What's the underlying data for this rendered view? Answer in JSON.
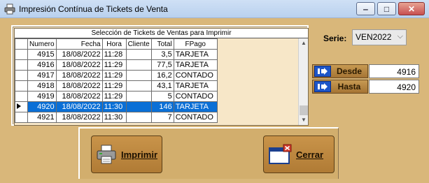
{
  "window": {
    "title": "Impresión Contínua de Tickets de Venta"
  },
  "grid": {
    "caption": "Selección de Tickets de Ventas para Imprimir",
    "columns": [
      "Numero",
      "Fecha",
      "Hora",
      "Cliente",
      "Total",
      "FPago"
    ],
    "rows": [
      {
        "numero": "4915",
        "fecha": "18/08/2022",
        "hora": "11:28",
        "cliente": "",
        "total": "3,5",
        "fpago": "TARJETA"
      },
      {
        "numero": "4916",
        "fecha": "18/08/2022",
        "hora": "11:29",
        "cliente": "",
        "total": "77,5",
        "fpago": "TARJETA"
      },
      {
        "numero": "4917",
        "fecha": "18/08/2022",
        "hora": "11:29",
        "cliente": "",
        "total": "16,2",
        "fpago": "CONTADO"
      },
      {
        "numero": "4918",
        "fecha": "18/08/2022",
        "hora": "11:29",
        "cliente": "",
        "total": "43,1",
        "fpago": "TARJETA"
      },
      {
        "numero": "4919",
        "fecha": "18/08/2022",
        "hora": "11:29",
        "cliente": "",
        "total": "5",
        "fpago": "CONTADO"
      },
      {
        "numero": "4920",
        "fecha": "18/08/2022",
        "hora": "11:30",
        "cliente": "",
        "total": "146",
        "fpago": "TARJETA"
      },
      {
        "numero": "4921",
        "fecha": "18/08/2022",
        "hora": "11:30",
        "cliente": "",
        "total": "7",
        "fpago": "CONTADO"
      }
    ],
    "selected_index": 5
  },
  "serie": {
    "label": "Serie:",
    "value": "VEN2022"
  },
  "range": {
    "desde_label": "Desde",
    "desde_value": "4916",
    "hasta_label": "Hasta",
    "hasta_value": "4920"
  },
  "actions": {
    "print_label": "Imprimir",
    "close_label": "Cerrar"
  },
  "icons": {
    "app": "printer-icon",
    "desde": "arrow-right-icon",
    "hasta": "arrow-right-icon",
    "print": "printer-icon",
    "close": "close-window-icon"
  },
  "colors": {
    "background": "#d9b77a",
    "selection": "#0a6fd6",
    "button": "#b07b35"
  }
}
